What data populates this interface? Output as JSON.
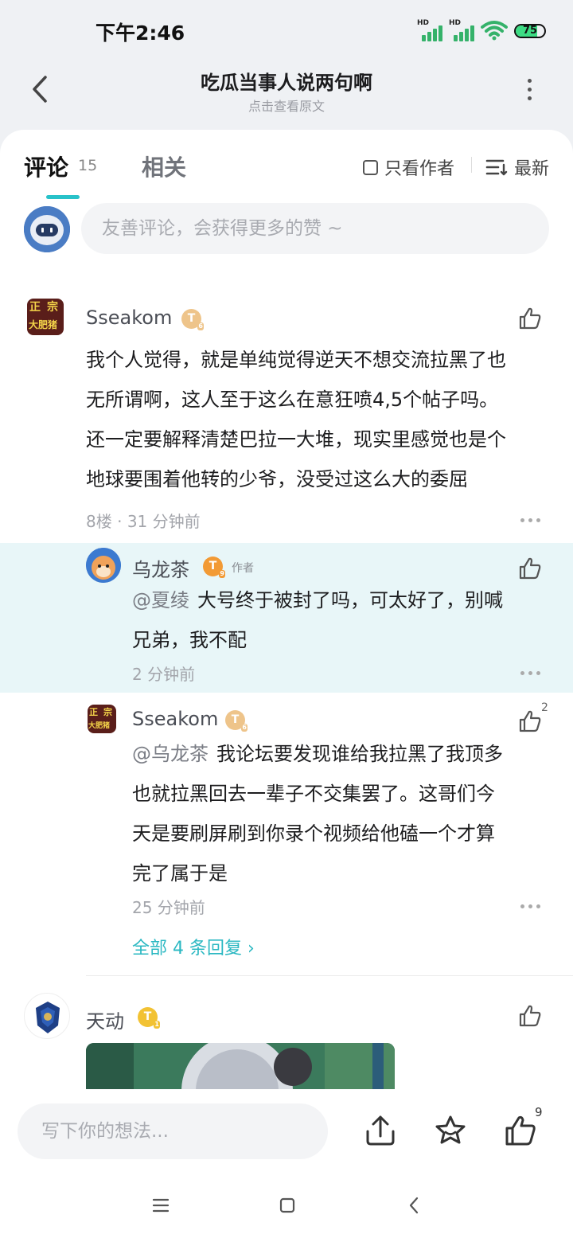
{
  "status": {
    "time": "下午2:46",
    "sim1": "HD",
    "sim2": "HD",
    "battery": "75",
    "battery_level": 0.75
  },
  "header": {
    "title": "吃瓜当事人说两句啊",
    "subtitle": "点击查看原文"
  },
  "tabs": {
    "comments_label": "评论",
    "comments_count": "15",
    "related_label": "相关",
    "only_author": "只看作者",
    "sort": "最新"
  },
  "compose": {
    "placeholder": "友善评论，会获得更多的赞 ~"
  },
  "comments": [
    {
      "user": "Sseakom",
      "level": "T",
      "avatar_text": [
        "正",
        "宗",
        "大肥猪"
      ],
      "lines": [
        "我个人觉得，就是单纯觉得逆天不想交流拉黑了也",
        "无所谓啊，这人至于这么在意狂喷4,5个帖子吗。",
        "还一定要解释清楚巴拉一大堆，现实里感觉也是个",
        "地球要围着他转的少爷，没受过这么大的委屈"
      ],
      "floor": "8楼",
      "sep": "·",
      "time": "31 分钟前"
    }
  ],
  "replies": [
    {
      "user": "乌龙茶",
      "level": "T",
      "author_tag": "作者",
      "mention": "@夏绫",
      "lines": [
        "大号终于被封了吗，可太好了，别喊",
        "兄弟，我不配"
      ],
      "time": "2 分钟前"
    },
    {
      "user": "Sseakom",
      "level": "T",
      "avatar_text": [
        "正",
        "宗",
        "大肥猪"
      ],
      "mention": "@乌龙茶",
      "lines": [
        "我论坛要发现谁给我拉黑了我顶多",
        "也就拉黑回去一辈子不交集罢了。这哥们今",
        "天是要刷屏刷到你录个视频给他磕一个才算",
        "完了属于是"
      ],
      "time": "25 分钟前",
      "likes": "2"
    }
  ],
  "view_all": "全部 4 条回复",
  "view_all_arrow": "›",
  "comment2": {
    "user": "天动",
    "level": "T"
  },
  "bottom": {
    "placeholder": "写下你的想法...",
    "like_count": "9"
  },
  "icons": [
    "back-icon",
    "more-icon",
    "checkbox-icon",
    "sort-icon",
    "thumb-up-icon",
    "share-icon",
    "star-icon",
    "menu-icon",
    "home-icon",
    "nav-back-icon"
  ],
  "colors": {
    "accent": "#28c2c9",
    "highlight": "#e8f6f8"
  }
}
